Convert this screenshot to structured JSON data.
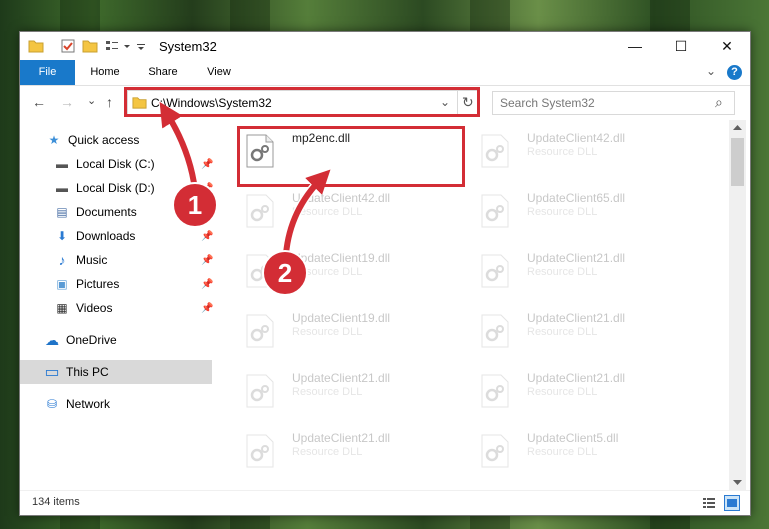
{
  "window": {
    "title": "System32",
    "min_glyph": "—",
    "max_glyph": "☐",
    "close_glyph": "✕"
  },
  "ribbon": {
    "tabs": [
      "File",
      "Home",
      "Share",
      "View"
    ],
    "help_glyph": "?",
    "collapse_glyph": "⌄"
  },
  "nav": {
    "back_glyph": "←",
    "forward_glyph": "→",
    "recent_glyph": "⌄",
    "up_glyph": "↑",
    "address": "C:\\Windows\\System32",
    "dropdown_glyph": "⌄",
    "refresh_glyph": "↻",
    "search_placeholder": "Search System32",
    "search_glyph": "⌕"
  },
  "sidebar": {
    "items": [
      {
        "label": "Quick access",
        "icon": "star-icon",
        "glyph": "★",
        "color": "#3c8fd8"
      },
      {
        "label": "Local Disk (C:)",
        "icon": "drive-icon",
        "glyph": "▬",
        "color": "#555555"
      },
      {
        "label": "Local Disk (D:)",
        "icon": "drive-icon",
        "glyph": "▬",
        "color": "#555555"
      },
      {
        "label": "Documents",
        "icon": "documents-icon",
        "glyph": "▤",
        "color": "#4a6fa5"
      },
      {
        "label": "Downloads",
        "icon": "download-icon",
        "glyph": "⬇",
        "color": "#2a7ad2"
      },
      {
        "label": "Music",
        "icon": "music-icon",
        "glyph": "♪",
        "color": "#2a7ad2"
      },
      {
        "label": "Pictures",
        "icon": "pictures-icon",
        "glyph": "▣",
        "color": "#5a9bd5"
      },
      {
        "label": "Videos",
        "icon": "videos-icon",
        "glyph": "▦",
        "color": "#333333"
      },
      {
        "label": "OneDrive",
        "icon": "cloud-icon",
        "glyph": "☁",
        "color": "#1e73c8"
      },
      {
        "label": "This PC",
        "icon": "computer-icon",
        "glyph": "▭",
        "color": "#2a7ad2"
      },
      {
        "label": "Network",
        "icon": "network-icon",
        "glyph": "⛁",
        "color": "#2a7ad2"
      }
    ],
    "pin_glyph": "📌"
  },
  "files": [
    {
      "name": "mp2enc.dll",
      "type": ""
    },
    {
      "name": "UpdateClient42.dll",
      "type": "Resource DLL"
    },
    {
      "name": "UpdateClient42.dll",
      "type": "Resource DLL"
    },
    {
      "name": "UpdateClient65.dll",
      "type": "Resource DLL"
    },
    {
      "name": "UpdateClient19.dll",
      "type": "Resource DLL"
    },
    {
      "name": "UpdateClient21.dll",
      "type": "Resource DLL"
    },
    {
      "name": "UpdateClient19.dll",
      "type": "Resource DLL"
    },
    {
      "name": "UpdateClient21.dll",
      "type": "Resource DLL"
    },
    {
      "name": "UpdateClient21.dll",
      "type": "Resource DLL"
    },
    {
      "name": "UpdateClient21.dll",
      "type": "Resource DLL"
    },
    {
      "name": "UpdateClient21.dll",
      "type": "Resource DLL"
    },
    {
      "name": "UpdateClient5.dll",
      "type": "Resource DLL"
    }
  ],
  "status": {
    "count": "134 items"
  },
  "annotations": {
    "badge1": "1",
    "badge2": "2",
    "color": "#d32d35"
  }
}
